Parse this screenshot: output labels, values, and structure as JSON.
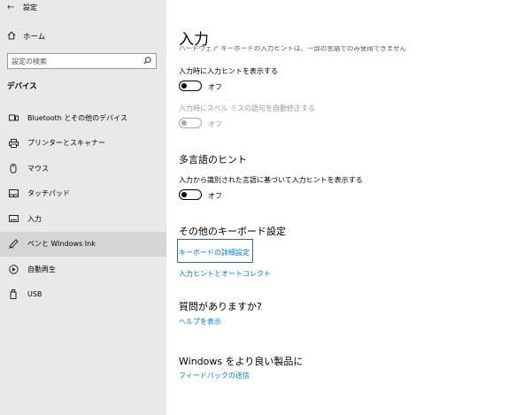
{
  "window": {
    "title": "設定",
    "controls": [
      "—",
      "☐",
      "✕"
    ]
  },
  "sidebar": {
    "home_label": "ホーム",
    "search_placeholder": "設定の検索",
    "section_label": "デバイス",
    "items": [
      {
        "label": "Bluetooth とその他のデバイス",
        "icon": "bluetooth-devices-icon"
      },
      {
        "label": "プリンターとスキャナー",
        "icon": "printer-icon"
      },
      {
        "label": "マウス",
        "icon": "mouse-icon"
      },
      {
        "label": "タッチパッド",
        "icon": "touchpad-icon"
      },
      {
        "label": "入力",
        "icon": "keyboard-icon"
      },
      {
        "label": "ペンと Windows Ink",
        "icon": "pen-icon",
        "active": true
      },
      {
        "label": "自動再生",
        "icon": "autoplay-icon"
      },
      {
        "label": "USB",
        "icon": "usb-icon"
      }
    ]
  },
  "main": {
    "title": "入力",
    "cut_text": "ハードウェア キーボードの入力ヒントは、一部の言語でのみ使用できません",
    "setting1_label": "入力時に入力ヒントを表示する",
    "setting1_state": "オフ",
    "setting2_label": "入力時にスペル ミスの語句を自動修正する",
    "setting2_state": "オフ",
    "multilang_heading": "多言語のヒント",
    "setting3_label": "入力から識別された言語に基づいて入力ヒントを表示する",
    "setting3_state": "オフ",
    "other_heading": "その他のキーボード設定",
    "link_advanced": "キーボードの詳細設定",
    "link_hints": "入力ヒントとオートコレクト",
    "question_heading": "質問がありますか?",
    "link_help": "ヘルプを表示",
    "better_heading": "Windows をより良い製品に",
    "link_feedback": "フィードバックの送信"
  },
  "colors": {
    "sidebar_bg": "#e9e9e9",
    "active_item_bg": "#d5d5d5",
    "link": "#0078d7",
    "focus": "#2c5fd8"
  }
}
